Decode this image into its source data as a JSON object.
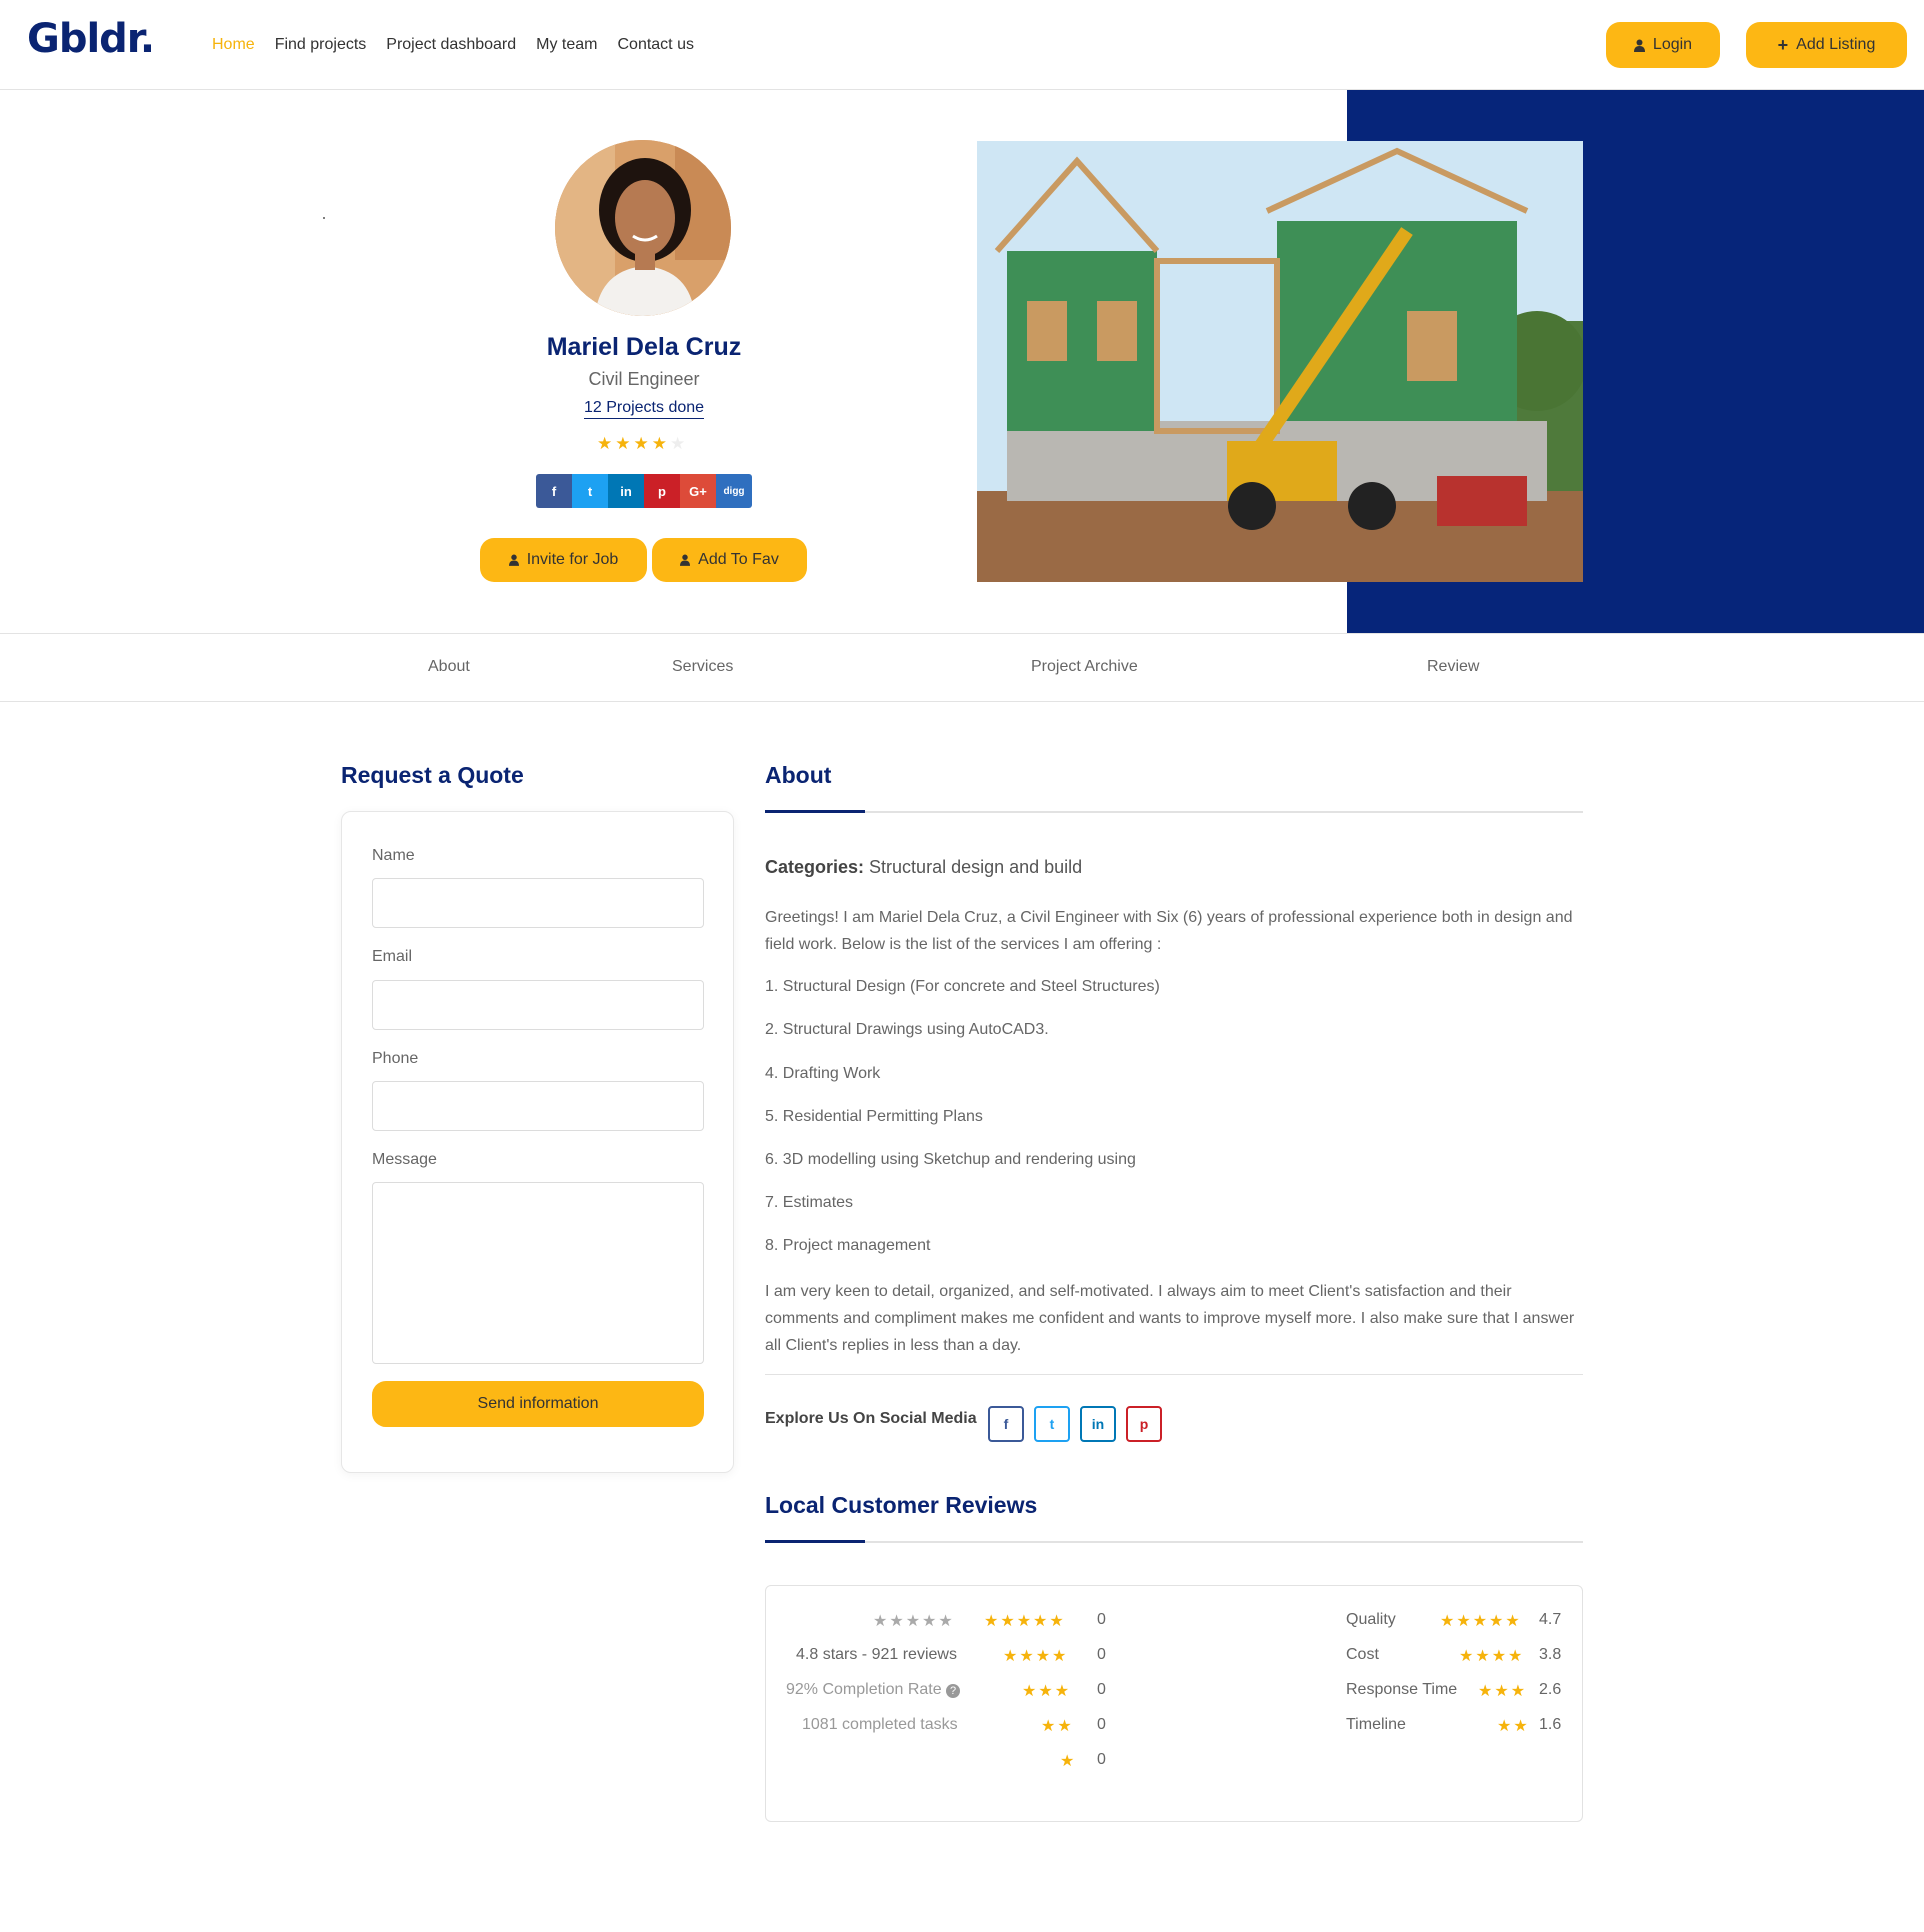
{
  "header": {
    "logo": "Gbldr.",
    "nav": [
      "Home",
      "Find projects",
      "Project dashboard",
      "My team",
      "Contact us"
    ],
    "login_label": "Login",
    "add_listing_label": "Add Listing"
  },
  "profile": {
    "name": "Mariel Dela Cruz",
    "role": "Civil Engineer",
    "projects_done": "12 Projects done",
    "rating_stars": 4,
    "rating_max": 5,
    "social": [
      "f",
      "t",
      "in",
      "p",
      "G+",
      "digg"
    ],
    "invite_label": "Invite for Job",
    "fav_label": "Add To Fav"
  },
  "tabs": [
    "About",
    "Services",
    "Project Archive",
    "Review"
  ],
  "quote": {
    "title": "Request a Quote",
    "name_label": "Name",
    "email_label": "Email",
    "phone_label": "Phone",
    "message_label": "Message",
    "send_label": "Send information"
  },
  "about": {
    "title": "About",
    "categories_label": "Categories:",
    "categories_value": "Structural design and build",
    "intro": "Greetings! I am Mariel Dela Cruz, a Civil Engineer with Six (6) years of professional experience both in design and field work. Below is the list of the services I am offering :",
    "services": [
      "1. Structural Design (For concrete and Steel Structures)",
      "2. Structural Drawings using AutoCAD3.",
      "4. Drafting Work",
      "5. Residential Permitting Plans",
      "6. 3D modelling using Sketchup and rendering using",
      "7. Estimates",
      "8. Project management"
    ],
    "closing": "I am very keen to detail, organized, and self-motivated. I always aim to meet Client's satisfaction and their comments and compliment makes me confident and wants to improve myself more. I also make sure that I answer all Client's replies in less than a day.",
    "explore_label": "Explore Us On Social Media"
  },
  "reviews": {
    "title": "Local Customer Reviews",
    "summary": [
      "4.8 stars - 921 reviews",
      "92% Completion Rate",
      "1081 completed tasks"
    ],
    "distribution": [
      {
        "stars": 5,
        "count": "0"
      },
      {
        "stars": 4,
        "count": "0"
      },
      {
        "stars": 3,
        "count": "0"
      },
      {
        "stars": 2,
        "count": "0"
      },
      {
        "stars": 1,
        "count": "0"
      }
    ],
    "criteria": [
      {
        "label": "Quality",
        "stars": 5,
        "value": "4.7"
      },
      {
        "label": "Cost",
        "stars": 4,
        "value": "3.8"
      },
      {
        "label": "Response Time",
        "stars": 3,
        "value": "2.6"
      },
      {
        "label": "Timeline",
        "stars": 2,
        "value": "1.6"
      }
    ]
  },
  "colors": {
    "brand_navy": "#0a2472",
    "accent_yellow": "#fdb714",
    "hero_blue": "#06257a"
  }
}
